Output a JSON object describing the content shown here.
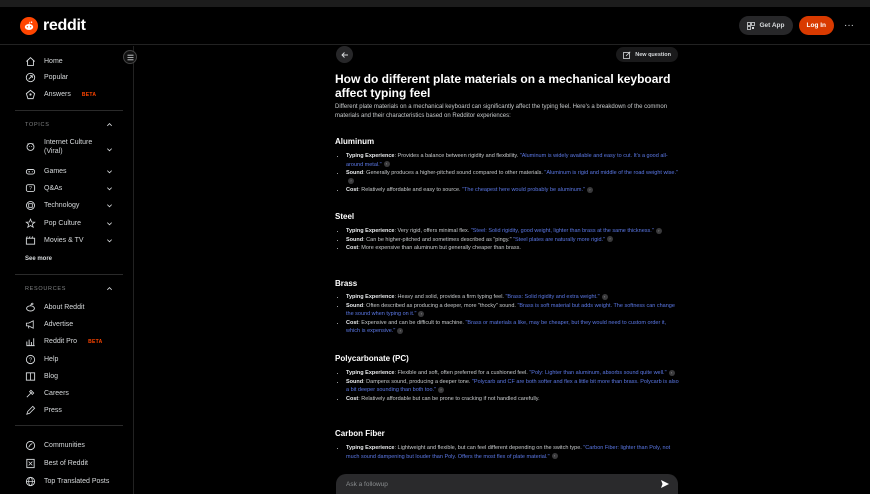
{
  "brand": {
    "name": "reddit",
    "color": "#ff4500"
  },
  "header": {
    "get_app": "Get App",
    "login": "Log In",
    "more": "···"
  },
  "sidebar": {
    "main": [
      {
        "label": "Home",
        "icon": "home-icon"
      },
      {
        "label": "Popular",
        "icon": "popular-icon"
      },
      {
        "label": "Answers",
        "icon": "answers-icon",
        "badge": "BETA"
      }
    ],
    "topics_label": "TOPICS",
    "topics": [
      {
        "label": "Internet Culture (Viral)",
        "icon": "internet-culture-icon"
      },
      {
        "label": "Games",
        "icon": "games-icon"
      },
      {
        "label": "Q&As",
        "icon": "qa-icon"
      },
      {
        "label": "Technology",
        "icon": "technology-icon"
      },
      {
        "label": "Pop Culture",
        "icon": "pop-culture-icon"
      },
      {
        "label": "Movies & TV",
        "icon": "movies-icon"
      }
    ],
    "see_more": "See more",
    "resources_label": "RESOURCES",
    "resources": [
      {
        "label": "About Reddit",
        "icon": "about-icon"
      },
      {
        "label": "Advertise",
        "icon": "advertise-icon"
      },
      {
        "label": "Reddit Pro",
        "icon": "reddit-pro-icon",
        "badge": "BETA"
      },
      {
        "label": "Help",
        "icon": "help-icon"
      },
      {
        "label": "Blog",
        "icon": "blog-icon"
      },
      {
        "label": "Careers",
        "icon": "careers-icon"
      },
      {
        "label": "Press",
        "icon": "press-icon"
      }
    ],
    "bottom": [
      {
        "label": "Communities",
        "icon": "communities-icon"
      },
      {
        "label": "Best of Reddit",
        "icon": "best-of-icon"
      },
      {
        "label": "Top Translated Posts",
        "icon": "translated-icon"
      }
    ]
  },
  "main": {
    "new_question": "New question",
    "title": "How do different plate materials on a mechanical keyboard affect typing feel",
    "intro": "Different plate materials on a mechanical keyboard can significantly affect the typing feel. Here's a breakdown of the common materials and their characteristics based on Redditor experiences:",
    "materials": [
      {
        "name": "Aluminum",
        "points": [
          {
            "label": "Typing Experience",
            "text": ": Provides a balance between rigidity and flexibility. ",
            "quote": "\"Aluminum is widely available and easy to cut. It's a good all-around metal.\""
          },
          {
            "label": "Sound",
            "text": ": Generally produces a higher-pitched sound compared to other materials. ",
            "quote": "\"Aluminum is rigid and middle of the road weight wise.\""
          },
          {
            "label": "Cost",
            "text": ": Relatively affordable and easy to source. ",
            "quote": "\"The cheapest here would probably be aluminum.\""
          }
        ]
      },
      {
        "name": "Steel",
        "points": [
          {
            "label": "Typing Experience",
            "text": ": Very rigid, offers minimal flex. ",
            "quote": "\"Steel: Solid rigidity, good weight, lighter than brass at the same thickness.\""
          },
          {
            "label": "Sound",
            "text": ": Can be higher-pitched and sometimes described as \"pingy.\" ",
            "quote": "\"Steel plates are naturally more rigid.\""
          },
          {
            "label": "Cost",
            "text": ": More expensive than aluminum but generally cheaper than brass.",
            "quote": ""
          }
        ]
      },
      {
        "name": "Brass",
        "points": [
          {
            "label": "Typing Experience",
            "text": ": Heavy and solid, provides a firm typing feel. ",
            "quote": "\"Brass: Solid rigidity and extra weight.\""
          },
          {
            "label": "Sound",
            "text": ": Often described as producing a deeper, more \"thocky\" sound. ",
            "quote": "\"Brass is soft material but adds weight. The softness can change the sound when typing on it.\""
          },
          {
            "label": "Cost",
            "text": ": Expensive and can be difficult to machine. ",
            "quote": "\"Brass or materials a like, may be cheaper, but they would need to custom order it, which is expensive.\""
          }
        ]
      },
      {
        "name": "Polycarbonate (PC)",
        "points": [
          {
            "label": "Typing Experience",
            "text": ": Flexible and soft, often preferred for a cushioned feel. ",
            "quote": "\"Poly: Lighter than aluminum, absorbs sound quite well.\""
          },
          {
            "label": "Sound",
            "text": ": Dampens sound, producing a deeper tone. ",
            "quote": "\"Polycarb and CF are both softer and flex a little bit more than brass. Polycarb is also a bit deeper sounding than both too.\""
          },
          {
            "label": "Cost",
            "text": ": Relatively affordable but can be prone to cracking if not handled carefully.",
            "quote": ""
          }
        ]
      },
      {
        "name": "Carbon Fiber",
        "points": [
          {
            "label": "Typing Experience",
            "text": ": Lightweight and flexible, but can feel different depending on the switch type. ",
            "quote": "\"Carbon Fiber: lighter than Poly, not much sound dampening but louder than Poly. Offers the most flex of plate material.\""
          }
        ]
      }
    ],
    "followup_placeholder": "Ask a followup"
  }
}
